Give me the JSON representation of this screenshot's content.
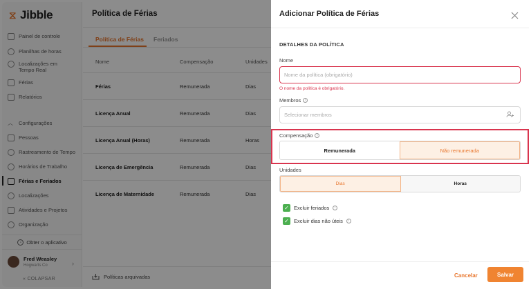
{
  "app": {
    "logo_text": "Jibble",
    "nav": [
      {
        "label": "Painel de controle",
        "icon": "dashboard-icon"
      },
      {
        "label": "Planilhas de horas",
        "icon": "clock-icon"
      },
      {
        "label": "Localizações em Tempo Real",
        "icon": "location-icon"
      },
      {
        "label": "Férias",
        "icon": "briefcase-icon"
      },
      {
        "label": "Relatórios",
        "icon": "report-icon"
      }
    ],
    "settings_nav": [
      {
        "label": "Configurações",
        "icon": "chevron-up-icon"
      },
      {
        "label": "Pessoas",
        "icon": "people-icon"
      },
      {
        "label": "Rastreamento de Tempo",
        "icon": "tracking-icon"
      },
      {
        "label": "Horários de Trabalho",
        "icon": "schedule-icon"
      },
      {
        "label": "Férias e Feriados",
        "icon": "vacation-icon",
        "active": true
      },
      {
        "label": "Localizações",
        "icon": "location-icon"
      },
      {
        "label": "Atividades e Projetos",
        "icon": "tag-icon"
      },
      {
        "label": "Organização",
        "icon": "gear-icon"
      }
    ],
    "get_app": "Obter o aplicativo",
    "user": {
      "name": "Fred Weasley",
      "org": "Hogwarts Co"
    },
    "collapse": "COLAPSAR"
  },
  "main": {
    "title": "Política de Férias",
    "tabs": [
      "Política de Férias",
      "Feriados"
    ],
    "columns": [
      "Nome",
      "Compensação",
      "Unidades"
    ],
    "rows": [
      {
        "name": "Férias",
        "comp": "Remunerada",
        "unit": "Dias"
      },
      {
        "name": "Licença Anual",
        "comp": "Remunerada",
        "unit": "Dias"
      },
      {
        "name": "Licença Anual (Horas)",
        "comp": "Remunerada",
        "unit": "Horas"
      },
      {
        "name": "Licença de Emergência",
        "comp": "Remunerada",
        "unit": "Dias"
      },
      {
        "name": "Licença de Maternidade",
        "comp": "Remunerada",
        "unit": "Dias"
      }
    ],
    "archived": "Políticas arquivadas"
  },
  "panel": {
    "title": "Adicionar Política de Férias",
    "section": "DETALHES DA POLÍTICA",
    "name_label": "Nome",
    "name_placeholder": "Nome da política (obrigatório)",
    "name_error": "O nome da política é obrigatório.",
    "members_label": "Membros",
    "members_placeholder": "Selecionar membros",
    "compensation_label": "Compensação",
    "compensation_options": [
      "Remunerada",
      "Não remunerada"
    ],
    "compensation_selected": "Não remunerada",
    "units_label": "Unidades",
    "units_options": [
      "Dias",
      "Horas"
    ],
    "units_selected": "Dias",
    "exclude_holidays": "Excluir feriados",
    "exclude_nonworking": "Excluir dias não úteis",
    "cancel": "Cancelar",
    "save": "Salvar"
  }
}
